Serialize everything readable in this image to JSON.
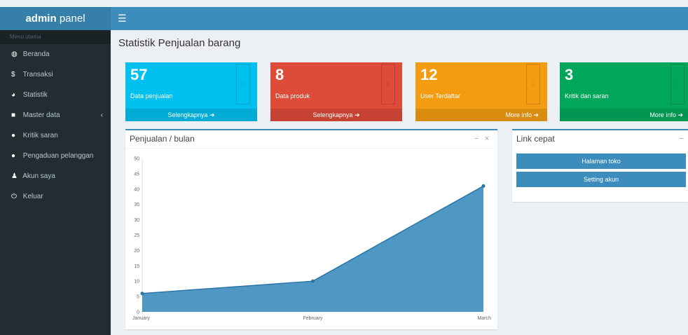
{
  "brand": {
    "bold": "admin",
    "rest": " panel"
  },
  "header": {
    "toggle_icon": "☰"
  },
  "sidebar": {
    "header": "Menu utama",
    "items": [
      {
        "icon": "dashboard-icon",
        "glyph": "◍",
        "label": "Beranda"
      },
      {
        "icon": "dollar-icon",
        "glyph": "$",
        "label": "Transaksi"
      },
      {
        "icon": "pie-chart-icon",
        "glyph": "◕",
        "label": "Statistik"
      },
      {
        "icon": "folder-icon",
        "glyph": "■",
        "label": "Master data",
        "chevron": "‹"
      },
      {
        "icon": "comments-icon",
        "glyph": "●",
        "label": "Kritik saran"
      },
      {
        "icon": "comments-icon",
        "glyph": "●",
        "label": "Pengaduan pelanggan"
      },
      {
        "icon": "user-icon",
        "glyph": "♟",
        "label": "Akun saya"
      },
      {
        "icon": "power-icon",
        "glyph": "⏻",
        "label": "Keluar"
      }
    ]
  },
  "page": {
    "title": "Statistik Penjualan barang"
  },
  "boxes": [
    {
      "value": "57",
      "label": "Data penjualan",
      "footer": "Selengkapnya ➔",
      "color": "#00c0ef"
    },
    {
      "value": "8",
      "label": "Data produk",
      "footer": "Selengkapnya ➔",
      "color": "#dd4b39"
    },
    {
      "value": "12",
      "label": "User Terdaftar",
      "footer": "More info ➔",
      "color": "#f39c12"
    },
    {
      "value": "3",
      "label": "Kritik dan saran",
      "footer": "More info ➔",
      "color": "#00a65a"
    }
  ],
  "chart_panel": {
    "title": "Penjualan / bulan",
    "minimize": "−",
    "close": "×"
  },
  "link_panel": {
    "title": "Link cepat",
    "minimize": "−",
    "buttons": [
      "Halaman toko",
      "Setting akun"
    ]
  },
  "chart_data": {
    "type": "area",
    "categories": [
      "January",
      "February",
      "March"
    ],
    "values": [
      6,
      10,
      41
    ],
    "ylim": [
      0,
      50
    ],
    "yticks": [
      0,
      5,
      10,
      15,
      20,
      25,
      30,
      35,
      40,
      45,
      50
    ],
    "color": "#3c8dbc",
    "grid": false
  }
}
